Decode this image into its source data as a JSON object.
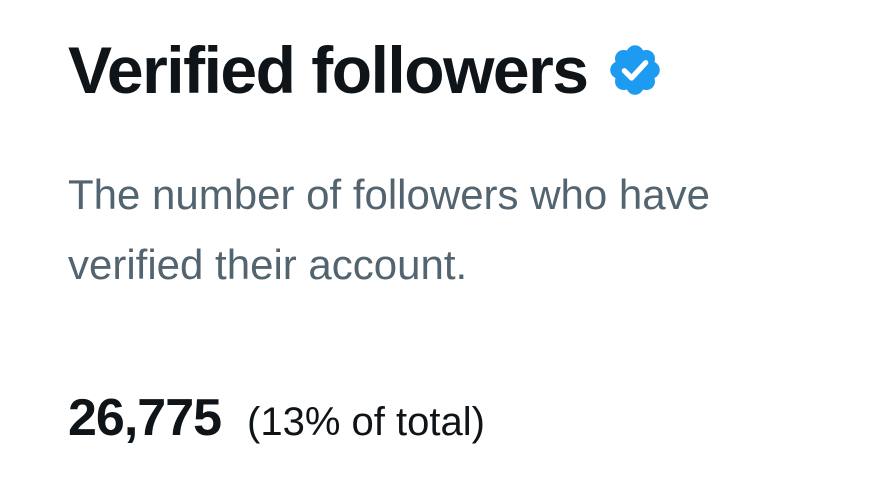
{
  "card": {
    "title": "Verified followers",
    "badge_icon": "verified-badge-icon",
    "badge_color": "#1d9bf0",
    "description": "The number of followers who have\nverified their account.",
    "stat": {
      "value": "26,775",
      "share": "(13% of total)"
    }
  }
}
